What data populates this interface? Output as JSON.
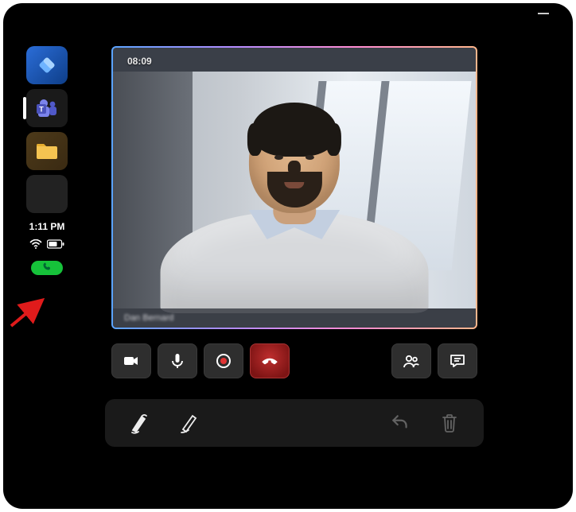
{
  "sidebar": {
    "apps": [
      {
        "id": "app-dynamics",
        "icon": "diamond-icon"
      },
      {
        "id": "app-teams",
        "icon": "teams-icon",
        "active": true
      },
      {
        "id": "app-files",
        "icon": "folder-icon"
      },
      {
        "id": "app-contact",
        "icon": "avatar-icon"
      }
    ],
    "time": "1:11 PM",
    "wifi": true,
    "battery": true,
    "active_call_indicator": true
  },
  "annotation": {
    "arrow_points_to": "active-call-pill"
  },
  "call": {
    "duration": "08:09",
    "participant_name": "Dan Bernard",
    "controls": {
      "camera": "camera-icon",
      "mic": "mic-icon",
      "record": "record-icon",
      "end": "end-call-icon",
      "people": "people-icon",
      "chat": "chat-icon"
    }
  },
  "toolbar": {
    "tools": {
      "pointer": "pointer-pen-icon",
      "pen": "pen-icon",
      "undo": "undo-icon",
      "delete": "trash-icon"
    }
  },
  "window": {
    "minimize": "—"
  }
}
